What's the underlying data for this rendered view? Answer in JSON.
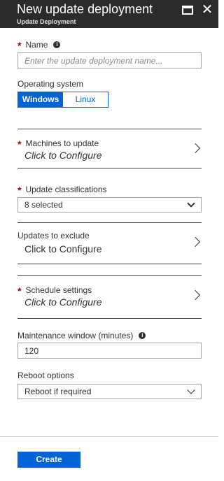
{
  "header": {
    "title": "New update deployment",
    "subtitle": "Update Deployment",
    "maximize_icon": "maximize-icon",
    "close_glyph": "✕"
  },
  "name_field": {
    "required_mark": "*",
    "label": "Name",
    "info_glyph": "i",
    "value": "",
    "placeholder": "Enter the update deployment name..."
  },
  "operating_system": {
    "label": "Operating system",
    "options": [
      "Windows",
      "Linux"
    ],
    "selected": "Windows"
  },
  "machines": {
    "required_mark": "*",
    "label": "Machines to update",
    "value": "Click to Configure"
  },
  "classifications": {
    "required_mark": "*",
    "label": "Update classifications",
    "selected": "8 selected"
  },
  "exclude": {
    "label": "Updates to exclude",
    "value": "Click to Configure"
  },
  "schedule": {
    "required_mark": "*",
    "label": "Schedule settings",
    "value": "Click to Configure"
  },
  "maintenance": {
    "label": "Maintenance window (minutes)",
    "info_glyph": "i",
    "value": "120"
  },
  "reboot": {
    "label": "Reboot options",
    "selected": "Reboot if required"
  },
  "footer": {
    "create_label": "Create"
  },
  "colors": {
    "header_bg": "#2b2b2b",
    "accent": "#0063d6",
    "required": "#a80000"
  }
}
